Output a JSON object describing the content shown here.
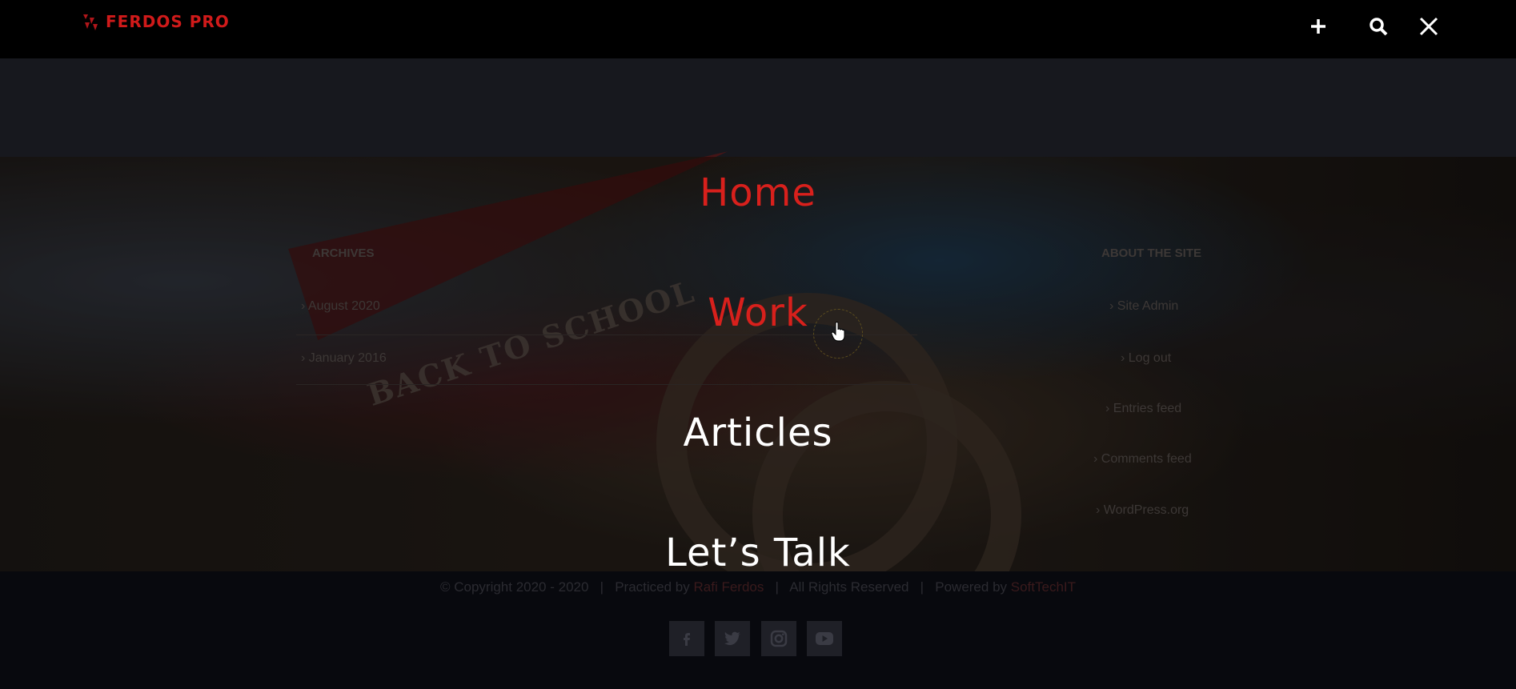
{
  "header": {
    "logo_text": "FERDOS PRO",
    "brand_color": "#d01a1a",
    "icons": [
      "plus-icon",
      "search-icon",
      "close-icon"
    ]
  },
  "menu": {
    "items": [
      {
        "label": "Home",
        "state": "active"
      },
      {
        "label": "Work",
        "state": "hover"
      },
      {
        "label": "Articles",
        "state": "normal"
      },
      {
        "label": "Let’s Talk",
        "state": "normal"
      }
    ],
    "active_color": "#d8201c"
  },
  "background": {
    "pennant_text": "BACK TO SCHOOL",
    "archives": {
      "heading": "ARCHIVES",
      "links": [
        "August 2020",
        "January 2016"
      ]
    },
    "meta": {
      "heading": "ABOUT THE SITE",
      "links": [
        "Site Admin",
        "Log out",
        "Entries feed",
        "Comments feed",
        "WordPress.org"
      ]
    }
  },
  "footer": {
    "copyright_prefix": "© Copyright 2020 - 2020",
    "practiced_by_label": "Practiced by",
    "author": "Rafi Ferdos",
    "rights": "All Rights Reserved",
    "powered_by_label": "Powered by",
    "powered_by": "SoftTechIT",
    "social": [
      "facebook-icon",
      "twitter-icon",
      "instagram-icon",
      "youtube-icon"
    ]
  }
}
